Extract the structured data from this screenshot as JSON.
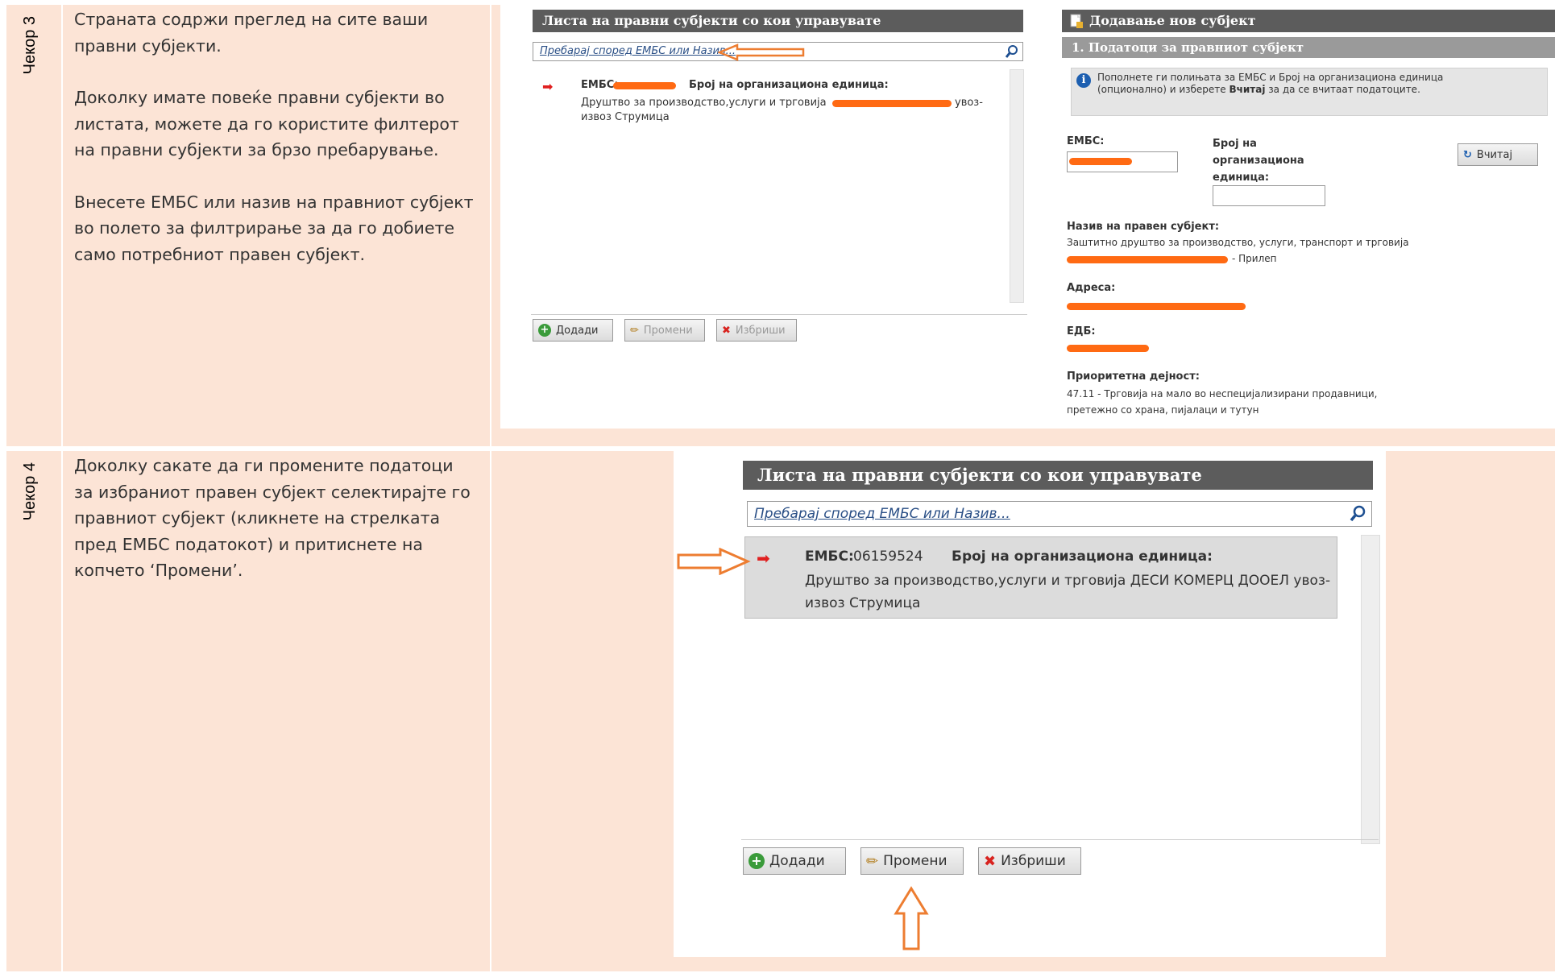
{
  "step3": {
    "label": "Чекор 3",
    "p1": "Страната  содржи преглед на сите ваши правни субјекти.",
    "p2": "Доколку имате повеќе правни субјекти во листата, можете да го користите филтерот на правни субјекти за брзо пребарување.",
    "p3": "Внесете ЕМБС или назив на правниот субјект во полето за филтрирање за да го добиете само потребниот правен субјект.",
    "list": {
      "title": "Листа на правни субјекти со кои управувате",
      "search_placeholder": "Пребарај според ЕМБС или Назив...",
      "item_embs_label": "ЕМБС:",
      "item_org_label": "Број на организациона единица:",
      "item_desc_1": "Друштво за производство,услуги и трговија",
      "item_desc_2": "увоз-",
      "item_desc_3": "извоз Струмица",
      "btn_add": "Додади",
      "btn_edit": "Промени",
      "btn_delete": "Избриши"
    },
    "form": {
      "title": "Додавање нов субјект",
      "section": "1.  Податоци за правниот субјект",
      "info_a": "Пополнете ги полињата за ЕМБС и Број на организациона единица (опционално) и изберете ",
      "info_bold": "Вчитај",
      "info_b": " за да се вчитаат податоците.",
      "embs_label": "ЕМБС:",
      "org_label_1": "Број на",
      "org_label_2": "организациона",
      "org_label_3": "единица:",
      "load_button": "Вчитај",
      "name_label": "Назив на правен субјект:",
      "name_value_1": "Заштитно друштво за производство, услуги, транспорт и трговија",
      "name_value_2": "- Прилеп",
      "address_label": "Адреса:",
      "edb_label": "ЕДБ:",
      "activity_label": "Приоритетна дејност:",
      "activity_value_1": "47.11 - Трговија на мало во неспецијализирани продавници,",
      "activity_value_2": "претежно со храна, пијалаци и тутун"
    }
  },
  "step4": {
    "label": "Чекор 4",
    "p1": "Доколку сакате да ги промените податоци за избраниот  правен субјект селектирајте го правниот субјект (кликнете на стрелката пред ЕМБС податокот) и притиснете на копчето ‘Промени’.",
    "list": {
      "title": "Листа на правни субјекти со кои управувате",
      "search_placeholder": "Пребарај според ЕМБС или Назив...",
      "item_embs_label": "ЕМБС:",
      "item_embs_value": "06159524",
      "item_org_label": "Број на организациона единица:",
      "item_desc_1": "Друштво за производство,услуги и трговија ДЕСИ КОМЕРЦ ДООЕЛ увоз-",
      "item_desc_2": "извоз Струмица",
      "btn_add": "Додади",
      "btn_edit": "Промени",
      "btn_delete": "Избриши"
    }
  },
  "colors": {
    "row_bg": "#fce4d6",
    "header_bar": "#5c5c5c",
    "redaction": "#ff6a13",
    "annotation_arrow": "#ed7d31"
  }
}
